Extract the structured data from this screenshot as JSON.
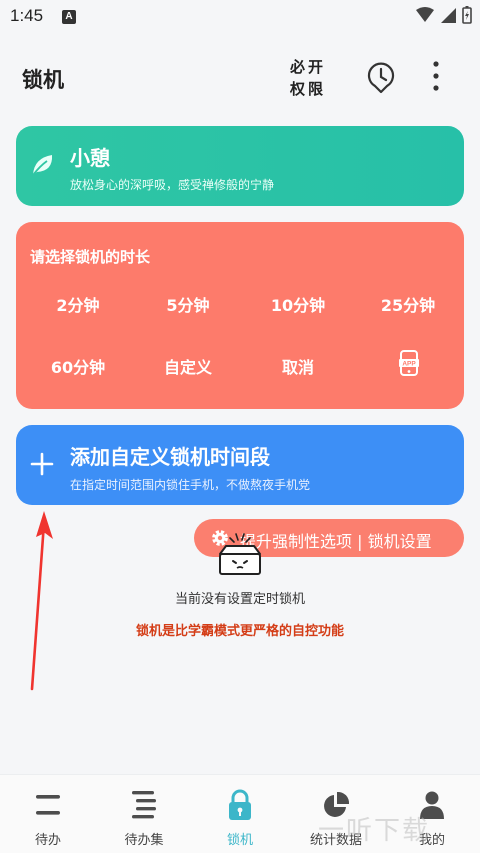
{
  "status": {
    "time": "1:45",
    "notif_letter": "A"
  },
  "header": {
    "title": "锁机",
    "perm_line1": "必开",
    "perm_line2": "权限"
  },
  "rest_card": {
    "title": "小憩",
    "subtitle": "放松身心的深呼吸，感受禅修般的宁静"
  },
  "timer_card": {
    "title": "请选择锁机的时长",
    "options": [
      "2分钟",
      "5分钟",
      "10分钟",
      "25分钟",
      "60分钟",
      "自定义",
      "取消"
    ],
    "app_icon_label": "APP"
  },
  "custom_card": {
    "title": "添加自定义锁机时间段",
    "subtitle": "在指定时间范围内锁住手机，不做熬夜手机党"
  },
  "boost": {
    "label": "提升强制性选项 | 锁机设置"
  },
  "empty": {
    "text": "当前没有设置定时锁机",
    "note": "锁机是比学霸模式更严格的自控功能"
  },
  "nav": {
    "items": [
      {
        "label": "待办",
        "icon": "todo-icon"
      },
      {
        "label": "待办集",
        "icon": "todo-set-icon"
      },
      {
        "label": "锁机",
        "icon": "lock-icon",
        "active": true
      },
      {
        "label": "统计数据",
        "icon": "stats-icon"
      },
      {
        "label": "我的",
        "icon": "profile-icon"
      }
    ]
  },
  "watermark": "一听下载",
  "colors": {
    "rest": "#2fc6a4",
    "timer": "#fd7b6b",
    "custom": "#3d8ff6",
    "active_nav": "#3cb6c9",
    "note": "#d43d17"
  }
}
